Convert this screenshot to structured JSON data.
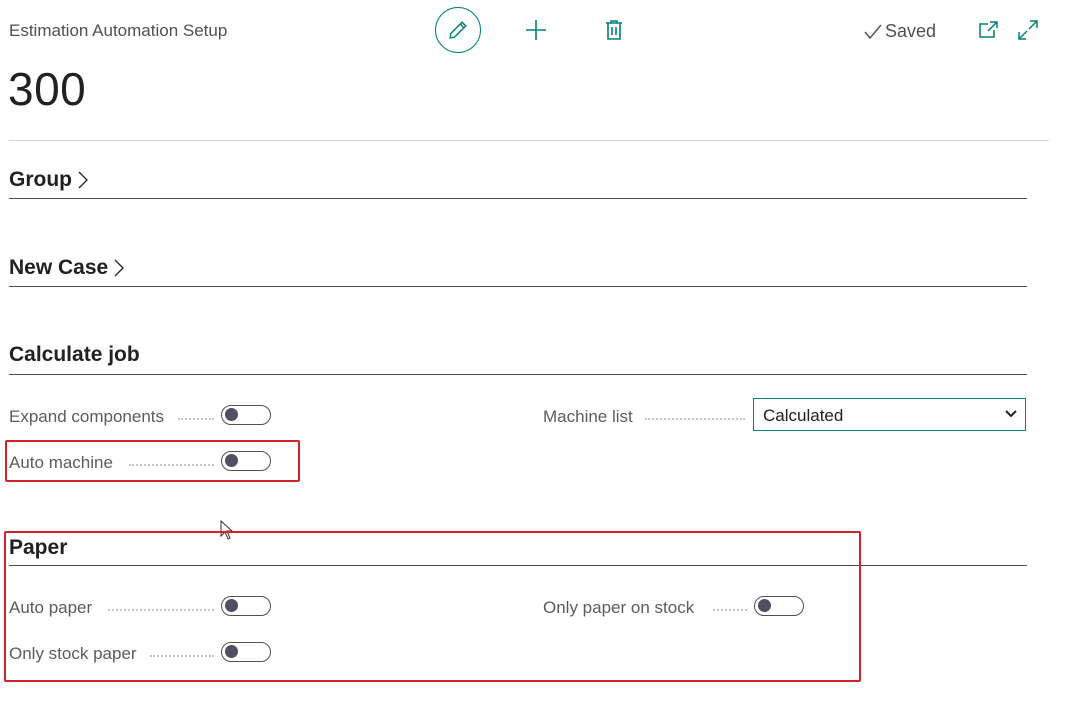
{
  "header": {
    "page_caption": "Estimation Automation Setup",
    "record_no": "300",
    "status": "Saved"
  },
  "sections": {
    "group": {
      "title": "Group"
    },
    "new_case": {
      "title": "New Case"
    },
    "calculate_job": {
      "title": "Calculate job",
      "expand_components": {
        "label": "Expand components",
        "value": false
      },
      "auto_machine": {
        "label": "Auto machine",
        "value": false
      },
      "machine_list": {
        "label": "Machine list",
        "value": "Calculated"
      }
    },
    "paper": {
      "title": "Paper",
      "auto_paper": {
        "label": "Auto paper",
        "value": false
      },
      "only_stock_paper": {
        "label": "Only stock paper",
        "value": false
      },
      "only_paper_on_stock": {
        "label": "Only paper on stock",
        "value": false
      }
    }
  },
  "colors": {
    "accent": "#00827a",
    "highlight_box": "#d3222a"
  },
  "icons": [
    "pencil-icon",
    "plus-icon",
    "trash-icon",
    "checkmark-icon",
    "open-new-window-icon",
    "expand-icon",
    "chevron-right-icon",
    "chevron-down-icon",
    "mouse-cursor-icon"
  ]
}
